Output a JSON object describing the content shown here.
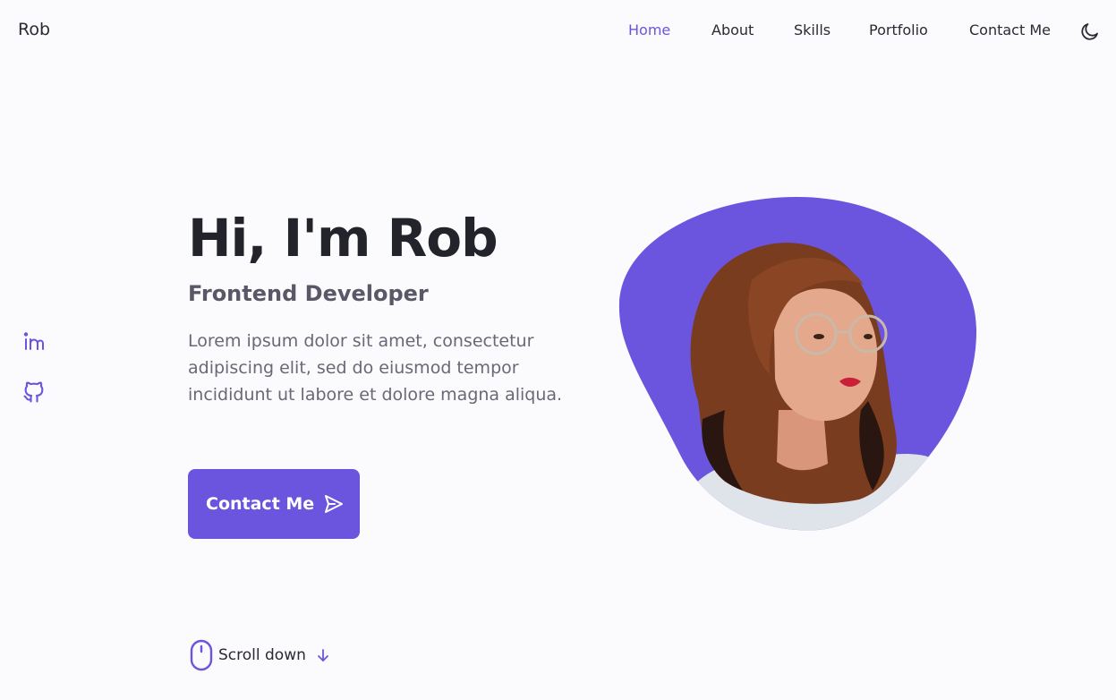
{
  "header": {
    "logo": "Rob",
    "nav": [
      {
        "label": "Home",
        "active": true
      },
      {
        "label": "About",
        "active": false
      },
      {
        "label": "Skills",
        "active": false
      },
      {
        "label": "Portfolio",
        "active": false
      },
      {
        "label": "Contact Me",
        "active": false
      }
    ],
    "theme_icon": "moon-icon"
  },
  "social": [
    {
      "icon": "linkedin-icon"
    },
    {
      "icon": "github-icon"
    }
  ],
  "hero": {
    "title": "Hi, I'm Rob",
    "subtitle": "Frontend Developer",
    "description": "Lorem ipsum dolor sit amet, consectetur adipiscing elit, sed do eiusmod tempor incididunt ut labore et dolore magna aliqua.",
    "button_label": "Contact Me",
    "button_icon": "send-icon",
    "image": "profile-photo"
  },
  "scroll": {
    "label": "Scroll down",
    "icon": "mouse-icon",
    "arrow_icon": "arrow-down-icon"
  },
  "colors": {
    "accent": "#6b55de",
    "background": "#fbfafd",
    "title": "#23232b",
    "text": "#6a6875"
  }
}
